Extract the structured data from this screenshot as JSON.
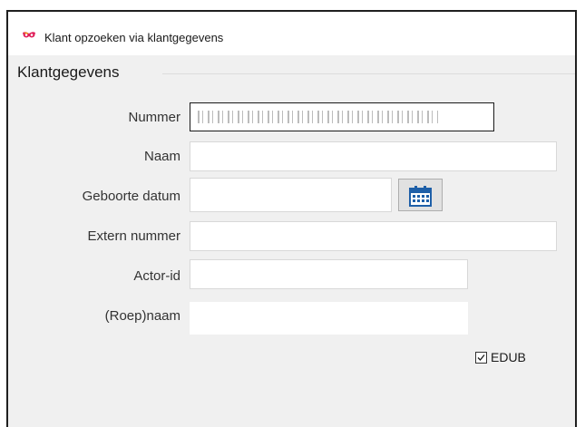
{
  "window": {
    "title": "Klant opzoeken via klantgegevens",
    "icon": "mask-icon"
  },
  "group": {
    "title": "Klantgegevens"
  },
  "fields": {
    "nummer": {
      "label": "Nummer",
      "value": ""
    },
    "naam": {
      "label": "Naam",
      "value": ""
    },
    "geboortedatum": {
      "label": "Geboorte datum",
      "value": "",
      "button_icon": "calendar-icon"
    },
    "extern_nummer": {
      "label": "Extern nummer",
      "value": ""
    },
    "actor_id": {
      "label": "Actor-id",
      "value": ""
    },
    "roepnaam": {
      "label": "(Roep)naam",
      "value": ""
    }
  },
  "checkbox": {
    "label": "EDUB",
    "checked": true
  },
  "colors": {
    "background": "#f0f0f0",
    "calendar_blue": "#1e5fa8",
    "icon_accent": "#e0205a"
  }
}
